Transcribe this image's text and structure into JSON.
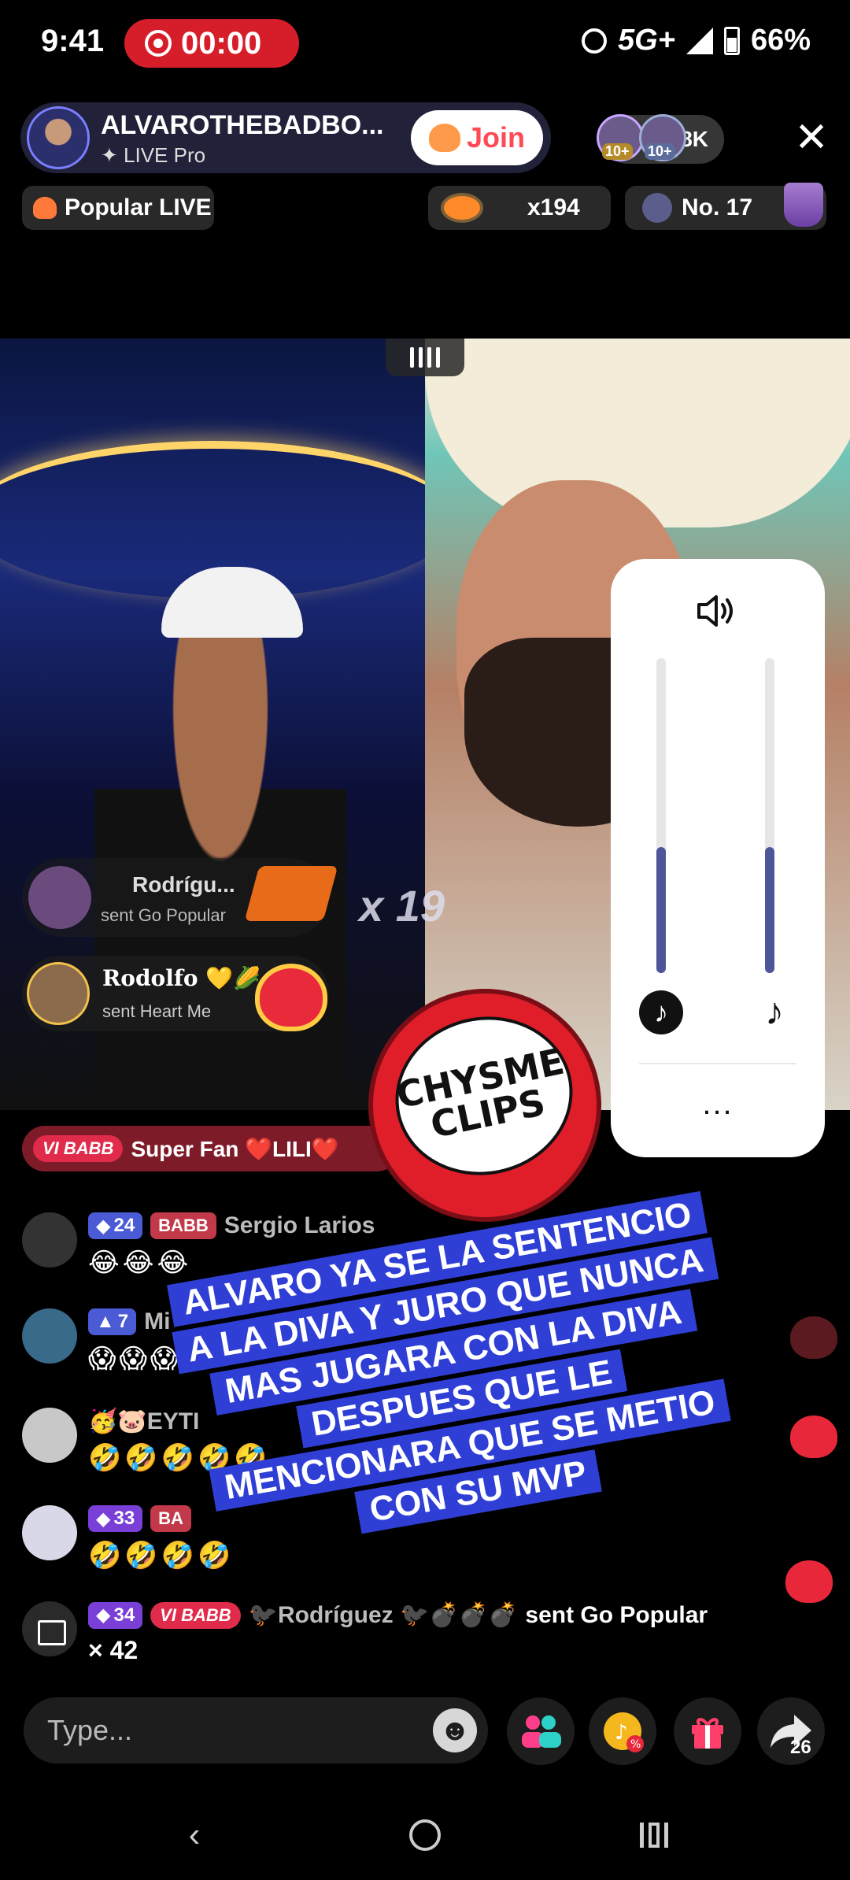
{
  "status_bar": {
    "time": "9:41",
    "record_timer": "00:00",
    "network": "5G+",
    "battery": "66%"
  },
  "live": {
    "host_name": "ALVAROTHEBADBO...",
    "host_subtitle": "✦ LIVE Pro",
    "join_label": "Join",
    "viewer_badges": [
      "10+",
      "10+"
    ],
    "viewer_count": "1.8K",
    "popular_label": "Popular LIVE",
    "gift_count": "x194",
    "rank": "No. 17"
  },
  "video": {
    "notifications": [
      {
        "name": "Rodrígu...",
        "text": "sent Go Popular"
      },
      {
        "name": "Rodolfo 💛🌽",
        "text": "sent Heart Me"
      }
    ],
    "gift_multiplier": "x 19"
  },
  "volume_panel": {
    "speaker_icon": "speaker-icon",
    "host_level": 0.4,
    "music_level": 0.4,
    "more_label": "..."
  },
  "superfan": {
    "badge": "VI BABB",
    "text": "Super Fan ❤️LILI❤️"
  },
  "logo": {
    "line1": "CHYSME",
    "line2": "CLIPS"
  },
  "chat": [
    {
      "level": "24",
      "team": "BABB",
      "name": "Sergio Larios",
      "message": "😂😂😂"
    },
    {
      "level": "7",
      "team": "",
      "name": "Mi",
      "message": "😱😱😱"
    },
    {
      "level": "",
      "team": "",
      "name": "🥳🐷EYTI",
      "message": "🤣🤣🤣🤣🤣"
    },
    {
      "level": "33",
      "team": "BA",
      "name": "",
      "message": "🤣🤣🤣🤣"
    }
  ],
  "gift_message": {
    "level": "34",
    "badge": "VI BABB",
    "name": "🐦‍⬛Rodríguez 🐦‍⬛💣💣💣",
    "text": "sent Go Popular",
    "count": "× 42"
  },
  "caption": [
    "ALVARO YA SE LA SENTENCIO",
    "A LA DIVA Y JURO QUE NUNCA",
    "MAS JUGARA CON LA DIVA",
    "DESPUES QUE LE",
    "MENCIONARA QUE SE METIO",
    "CON SU MVP"
  ],
  "bottom_bar": {
    "input_placeholder": "Type...",
    "share_count": "26"
  },
  "colors": {
    "record_red": "#d61e2b",
    "join_text": "#fe4a55",
    "caption_blue": "#2f3fd6",
    "slider_fill": "#4e5598"
  }
}
